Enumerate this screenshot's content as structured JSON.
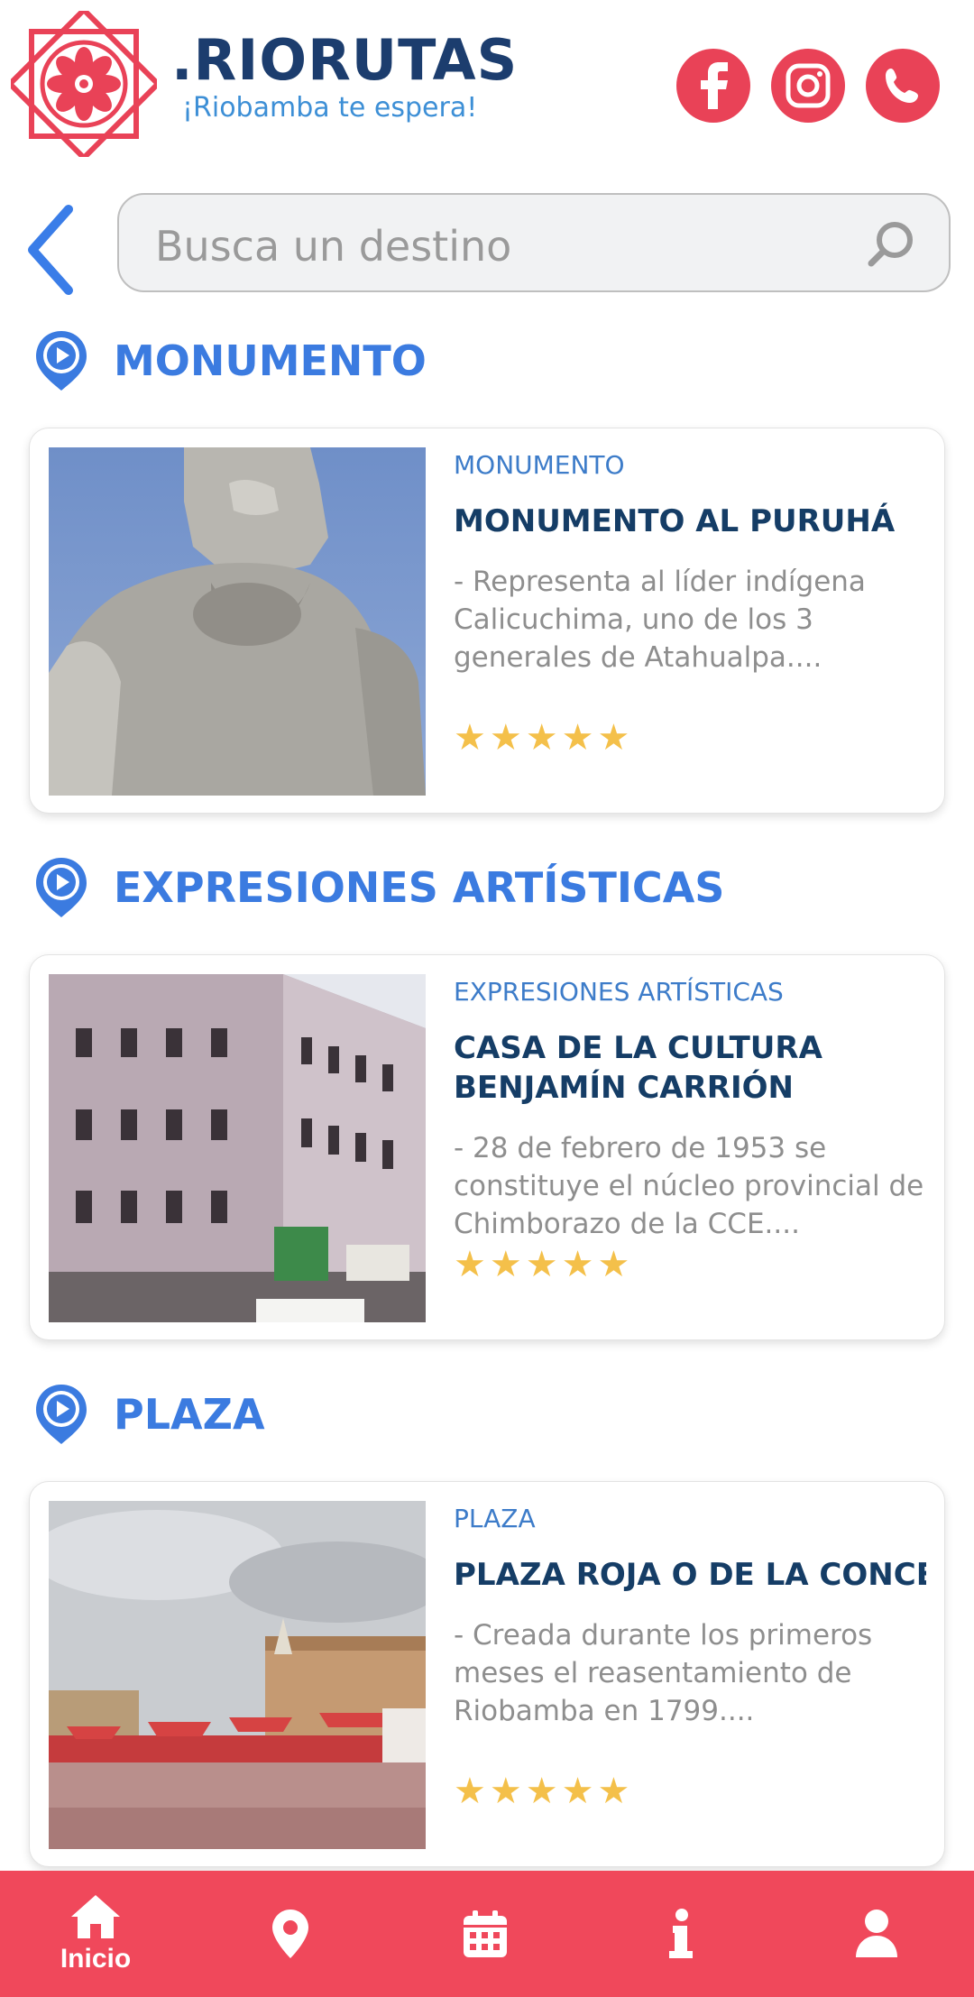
{
  "header": {
    "brand_name": ".RIORUTAS",
    "tagline": "¡Riobamba te espera!",
    "social": [
      "facebook-icon",
      "instagram-icon",
      "whatsapp-icon"
    ]
  },
  "search": {
    "placeholder": "Busca un destino"
  },
  "sections": [
    {
      "title": "MONUMENTO",
      "card": {
        "category": "MONUMENTO",
        "name": "MONUMENTO AL PURUHÁ",
        "description": "- Representa al líder indígena Calicuchima, uno de los 3 generales de Atahualpa....",
        "rating": 5
      }
    },
    {
      "title": "EXPRESIONES ARTÍSTICAS",
      "card": {
        "category": "EXPRESIONES ARTÍSTICAS",
        "name": "CASA DE LA CULTURA BENJAMÍN CARRIÓN NÚCLEO DE CHIMBORAZO",
        "description": "- 28 de febrero de 1953 se constituye el núcleo provincial de Chimborazo de la CCE....",
        "rating": 5
      }
    },
    {
      "title": "PLAZA",
      "card": {
        "category": "PLAZA",
        "name": "PLAZA ROJA O DE LA CONCEPCIÓN",
        "description": "- Creada durante los primeros meses el reasentamiento de Riobamba en 1799....",
        "rating": 5
      }
    }
  ],
  "nav": {
    "items": [
      {
        "icon": "home-icon",
        "label": "Inicio"
      },
      {
        "icon": "location-pin-icon",
        "label": ""
      },
      {
        "icon": "calendar-icon",
        "label": ""
      },
      {
        "icon": "info-icon",
        "label": ""
      },
      {
        "icon": "user-icon",
        "label": ""
      }
    ]
  },
  "colors": {
    "brand_red": "#e94257",
    "accent_blue": "#3b7be0",
    "title_navy": "#153d66",
    "star": "#f4c04a"
  }
}
